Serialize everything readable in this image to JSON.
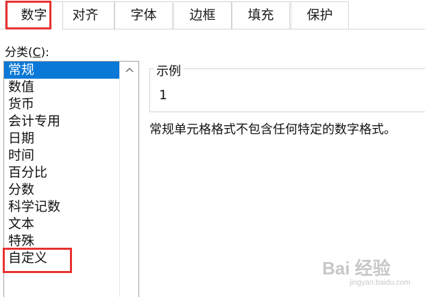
{
  "tabs": [
    {
      "label": "数字",
      "active": true
    },
    {
      "label": "对齐",
      "active": false
    },
    {
      "label": "字体",
      "active": false
    },
    {
      "label": "边框",
      "active": false
    },
    {
      "label": "填充",
      "active": false
    },
    {
      "label": "保护",
      "active": false
    }
  ],
  "category": {
    "label_prefix": "分类(",
    "label_hotkey": "C",
    "label_suffix": "):",
    "items": [
      "常规",
      "数值",
      "货币",
      "会计专用",
      "日期",
      "时间",
      "百分比",
      "分数",
      "科学记数",
      "文本",
      "特殊",
      "自定义"
    ],
    "selected_index": 0
  },
  "sample": {
    "legend": "示例",
    "value": "1"
  },
  "description": "常规单元格格式不包含任何特定的数字格式。",
  "watermark": {
    "text": "Bai 经验",
    "sub": "jingyan.baidu.com"
  },
  "colors": {
    "selection": "#0a78d7",
    "highlight": "#e8312f"
  },
  "icons": {
    "scroll_up": "chevron-up-icon",
    "watermark_paw": "paw-icon"
  }
}
